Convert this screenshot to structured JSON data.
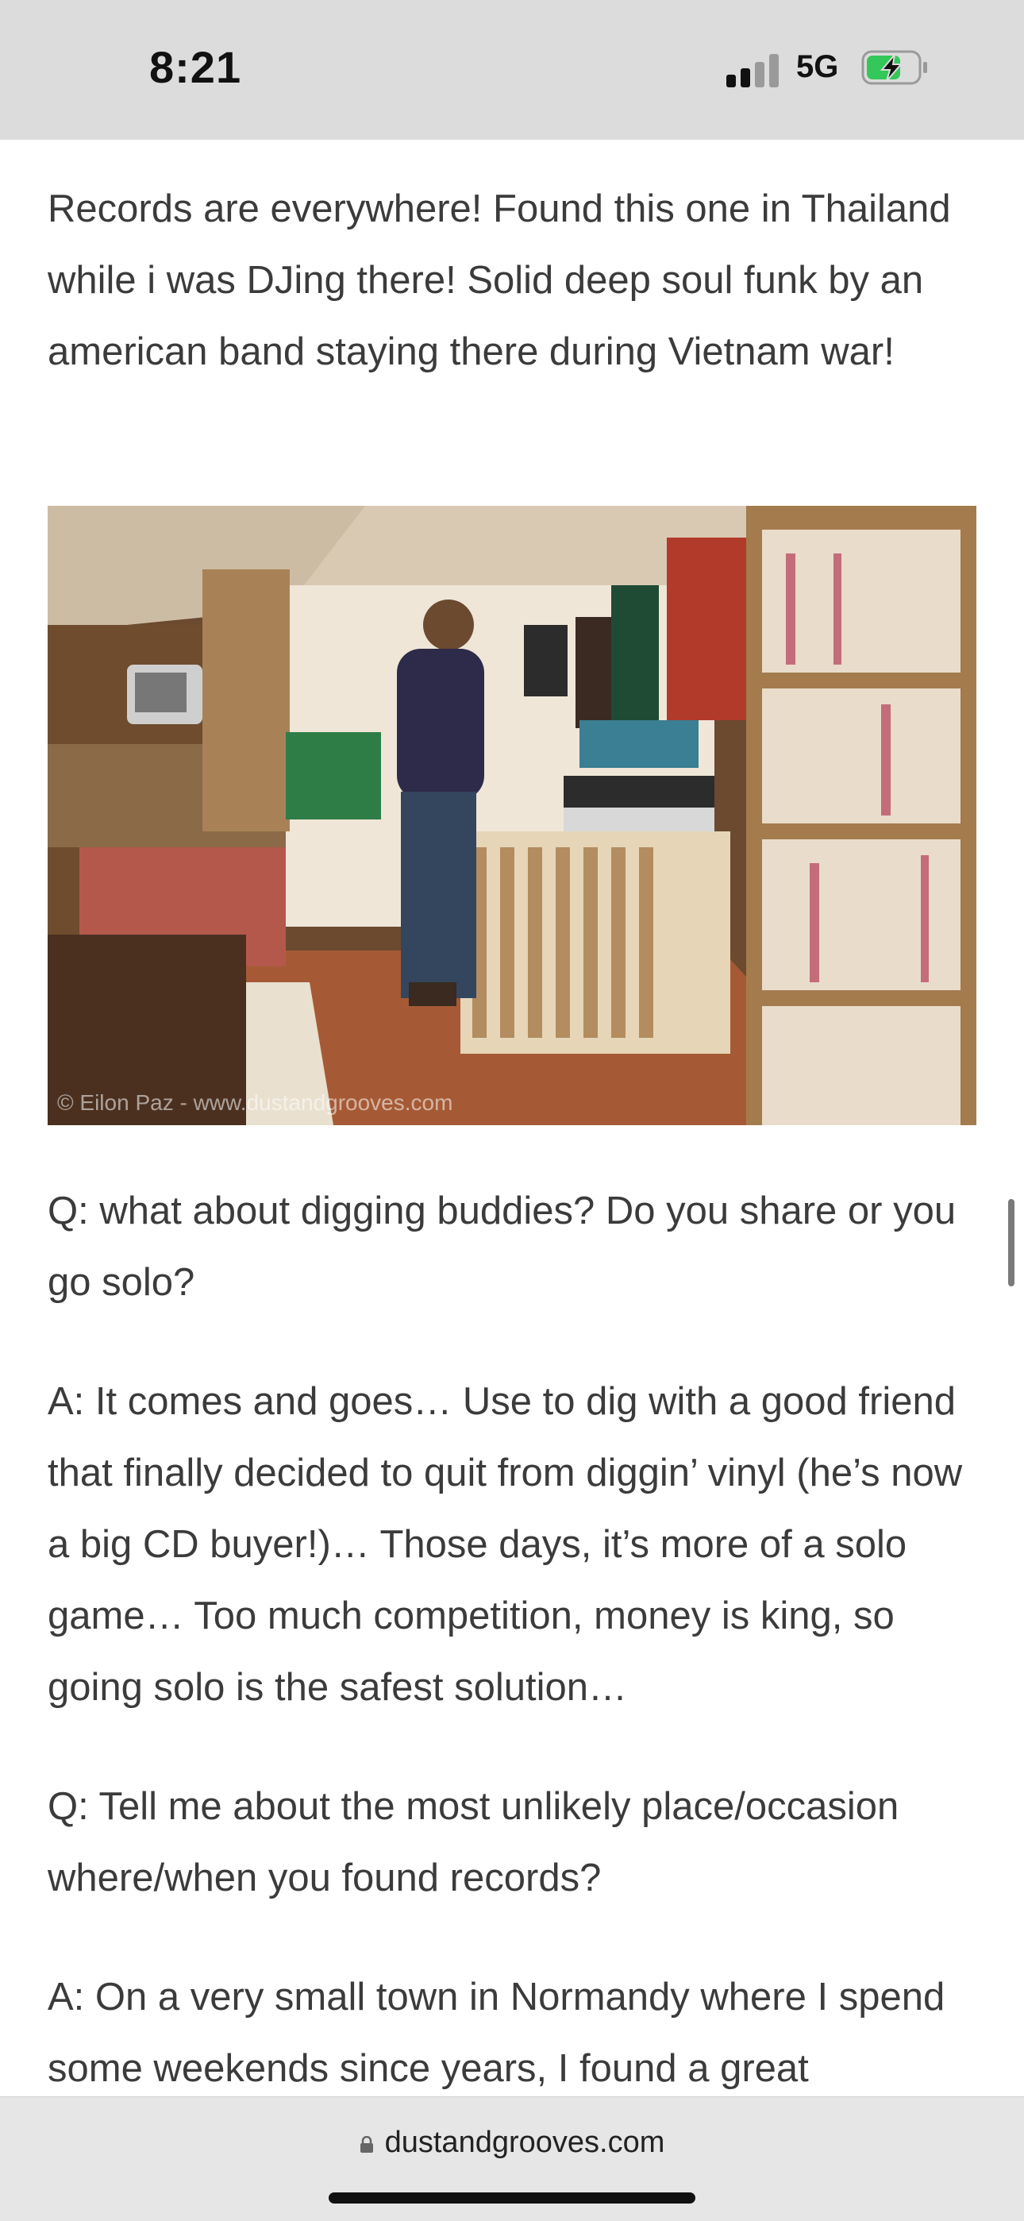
{
  "status_bar": {
    "time": "8:21",
    "network": "5G"
  },
  "article": {
    "paragraphs": [
      "Records are everywhere! Found this one in Thailand while i was DJing there! Solid deep soul funk by an american band staying there during Vietnam war!",
      "Q: what about digging buddies? Do you share or you go solo?",
      "A: It comes and goes… Use to dig with a good friend that finally decided to quit from diggin’ vinyl (he’s now a big CD buyer!)… Those days, it’s more of a solo game… Too much competition, money is king, so going solo is the safest solution…",
      "Q: Tell me about the most unlikely place/occasion where/when you found records?",
      "A: On a very small town in Normandy where I spend some weekends since years, I found a great"
    ],
    "photo_credit": "© Eilon Paz - www.dustandgrooves.com"
  },
  "browser": {
    "url": "dustandgrooves.com"
  },
  "colors": {
    "status_bg": "#dcdcdc",
    "battery_green": "#34c759",
    "text": "#3b3b3b"
  }
}
